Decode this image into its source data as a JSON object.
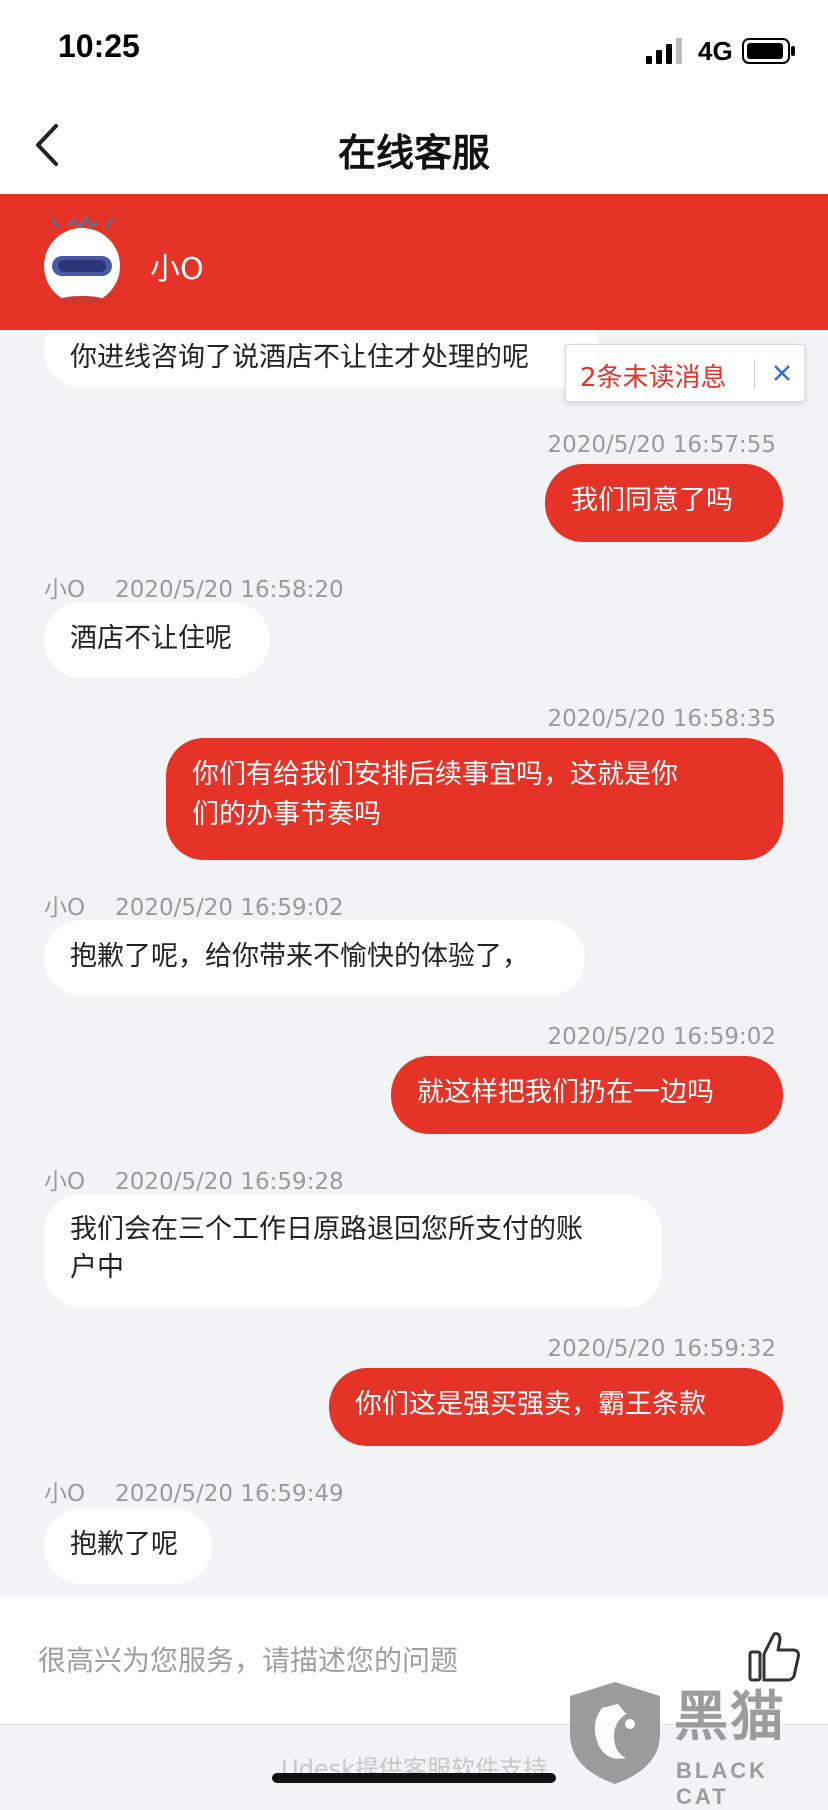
{
  "status_bar": {
    "time": "10:25",
    "network": "4G",
    "signal_icon": "signal-bars-icon",
    "battery_icon": "battery-icon"
  },
  "nav": {
    "title": "在线客服",
    "back_icon": "chevron-left-icon"
  },
  "agent": {
    "name": "小O",
    "avatar_icon": "robot-avatar-icon"
  },
  "unread": {
    "label": "2条未读消息",
    "close_icon": "close-x-icon"
  },
  "messages": [
    {
      "side": "left",
      "sender": "",
      "time": "",
      "lines": [
        "你进线咨询了说酒店不让住才处理的呢"
      ]
    },
    {
      "side": "right",
      "time": "2020/5/20 16:57:55",
      "lines": [
        "我们同意了吗"
      ]
    },
    {
      "side": "left",
      "sender": "小O",
      "time": "2020/5/20 16:58:20",
      "lines": [
        "酒店不让住呢"
      ]
    },
    {
      "side": "right",
      "time": "2020/5/20 16:58:35",
      "lines": [
        "你们有给我们安排后续事宜吗，这就是你",
        "们的办事节奏吗"
      ]
    },
    {
      "side": "left",
      "sender": "小O",
      "time": "2020/5/20 16:59:02",
      "lines": [
        "抱歉了呢，给你带来不愉快的体验了，"
      ]
    },
    {
      "side": "right",
      "time": "2020/5/20 16:59:02",
      "lines": [
        "就这样把我们扔在一边吗"
      ]
    },
    {
      "side": "left",
      "sender": "小O",
      "time": "2020/5/20 16:59:28",
      "lines": [
        "我们会在三个工作日原路退回您所支付的账",
        "户中"
      ]
    },
    {
      "side": "right",
      "time": "2020/5/20 16:59:32",
      "lines": [
        "你们这是强买强卖，霸王条款"
      ]
    },
    {
      "side": "left",
      "sender": "小O",
      "time": "2020/5/20 16:59:49",
      "lines": [
        "抱歉了呢"
      ]
    }
  ],
  "input": {
    "placeholder": "很高兴为您服务，请描述您的问题",
    "value": "",
    "thumb_icon": "thumbs-up-icon"
  },
  "footer": {
    "powered_by": "Udesk提供客服软件支持"
  },
  "watermark": {
    "text": "黑猫",
    "sub": "BLACK CAT",
    "logo_icon": "black-cat-shield-icon"
  },
  "colors": {
    "accent": "#e53327",
    "background": "#f2f3f5",
    "bubble_left": "#ffffff",
    "meta_gray": "#9a9a9a",
    "link_blue": "#2f6fd6"
  }
}
